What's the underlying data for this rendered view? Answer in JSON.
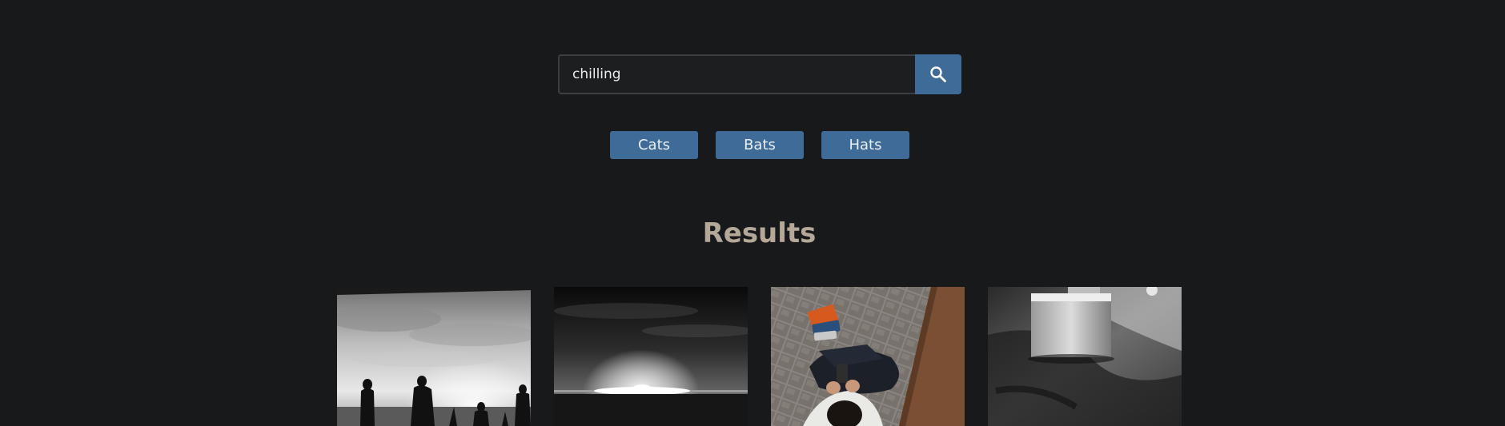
{
  "search": {
    "value": "chilling",
    "button_icon": "search-icon"
  },
  "suggestions": [
    {
      "label": "Cats"
    },
    {
      "label": "Bats"
    },
    {
      "label": "Hats"
    }
  ],
  "results": {
    "heading": "Results",
    "items": [
      {
        "subject": "silhouettes-by-sea-bw"
      },
      {
        "subject": "sunset-horizon-bw"
      },
      {
        "subject": "person-on-cobblestones-color"
      },
      {
        "subject": "stone-block-on-ground-bw"
      }
    ]
  },
  "colors": {
    "background": "#18191b",
    "accent": "#3e6b98",
    "heading": "#b4a998",
    "input_bg": "#1c1e20",
    "input_border": "#3b3f44"
  }
}
